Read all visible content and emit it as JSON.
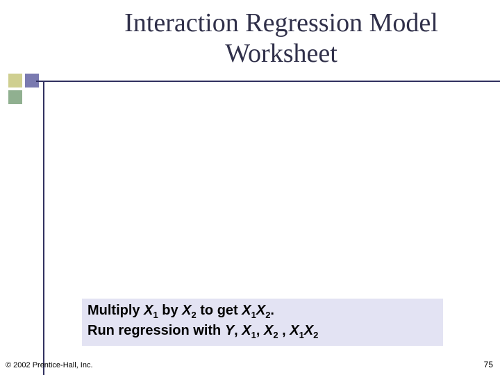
{
  "title": "Interaction Regression Model Worksheet",
  "callout": {
    "line1": {
      "pre": "Multiply ",
      "x1": "X",
      "s1": "1",
      "mid": " by ",
      "x2": "X",
      "s2": "2",
      "mid2": " to get ",
      "x3": "X",
      "s3": "1",
      "x4": "X",
      "s4": "2",
      "end": "."
    },
    "line2": {
      "pre": "Run regression with ",
      "y": "Y",
      "c1": ", ",
      "x1": "X",
      "s1": "1",
      "c2": ", ",
      "x2": "X",
      "s2": "2",
      "c3": " , ",
      "x3": "X",
      "s3": "1",
      "x4": "X",
      "s4": "2"
    }
  },
  "footer": {
    "copyright": "© 2002 Prentice-Hall, Inc.",
    "page": "75"
  }
}
